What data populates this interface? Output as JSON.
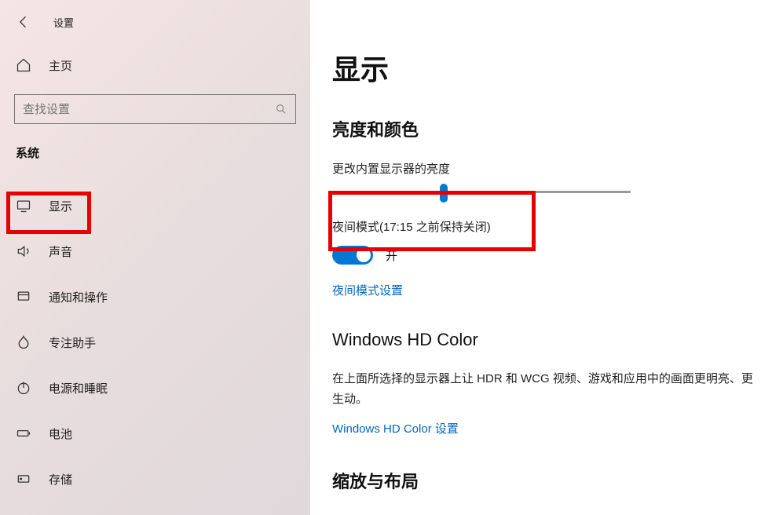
{
  "header": {
    "settings_title": "设置"
  },
  "sidebar": {
    "home_label": "主页",
    "search_placeholder": "查找设置",
    "section_label": "系统",
    "items": [
      {
        "label": "显示"
      },
      {
        "label": "声音"
      },
      {
        "label": "通知和操作"
      },
      {
        "label": "专注助手"
      },
      {
        "label": "电源和睡眠"
      },
      {
        "label": "电池"
      },
      {
        "label": "存储"
      }
    ]
  },
  "main": {
    "page_title": "显示",
    "brightness": {
      "heading": "亮度和颜色",
      "slider_label": "更改内置显示器的亮度",
      "slider_percent": 36
    },
    "night_mode": {
      "label": "夜间模式(17:15 之前保持关闭)",
      "state": "开",
      "settings_link": "夜间模式设置"
    },
    "hd_color": {
      "heading": "Windows HD Color",
      "desc": "在上面所选择的显示器上让 HDR 和 WCG 视频、游戏和应用中的画面更明亮、更生动。",
      "link": "Windows HD Color 设置"
    },
    "scale": {
      "heading": "缩放与布局"
    }
  }
}
